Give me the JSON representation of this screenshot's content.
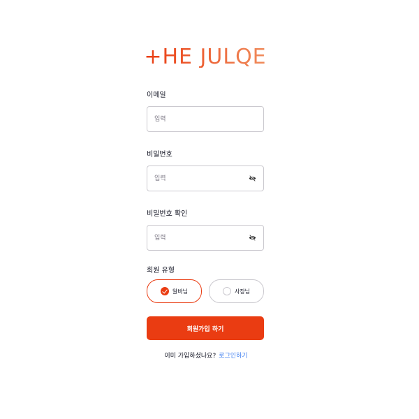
{
  "brand": {
    "logo_text": "+HE JULQE",
    "accent_color": "#ea3c12"
  },
  "form": {
    "email": {
      "label": "이메일",
      "placeholder": "입력"
    },
    "password": {
      "label": "비밀번호",
      "placeholder": "입력",
      "toggle_icon": "eye-slash-icon"
    },
    "password_confirm": {
      "label": "비밀번호 확인",
      "placeholder": "입력",
      "toggle_icon": "eye-slash-icon"
    },
    "member_type": {
      "label": "회원 유형",
      "options": [
        {
          "label": "알바님",
          "selected": true
        },
        {
          "label": "사장님",
          "selected": false
        }
      ]
    },
    "submit_label": "회원가입 하기"
  },
  "footer": {
    "question": "이미 가입하셨나요?",
    "login_link": "로그인하기"
  }
}
